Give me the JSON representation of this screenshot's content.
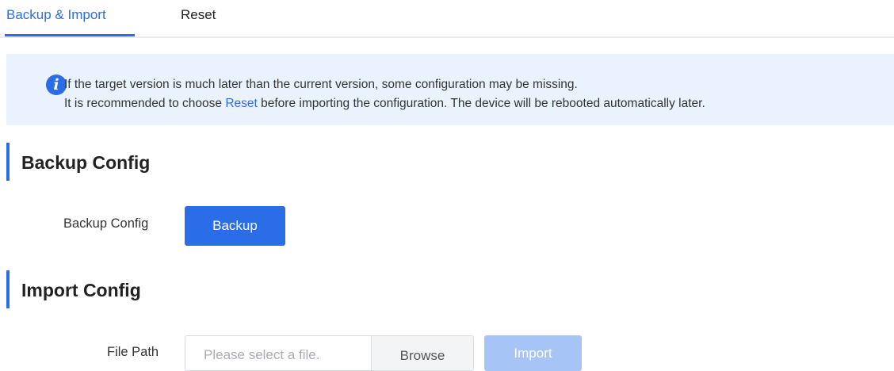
{
  "tabs": [
    {
      "label": "Backup & Import",
      "active": true
    },
    {
      "label": "Reset",
      "active": false
    }
  ],
  "notice": {
    "icon": "info-icon",
    "line1": "If the target version is much later than the current version, some configuration may be missing.",
    "line2_prefix": "It is recommended to choose ",
    "line2_link": "Reset",
    "line2_suffix": " before importing the configuration. The device will be rebooted automatically later."
  },
  "backup": {
    "section_title": "Backup Config",
    "field_label": "Backup Config",
    "button_label": "Backup"
  },
  "import": {
    "section_title": "Import Config",
    "field_label": "File Path",
    "file_placeholder": "Please select a file.",
    "browse_label": "Browse",
    "import_label": "Import",
    "import_disabled": true
  },
  "colors": {
    "accent": "#2b6de6",
    "notice_bg": "#eaf3fd",
    "disabled_button": "#a6c4f5"
  }
}
